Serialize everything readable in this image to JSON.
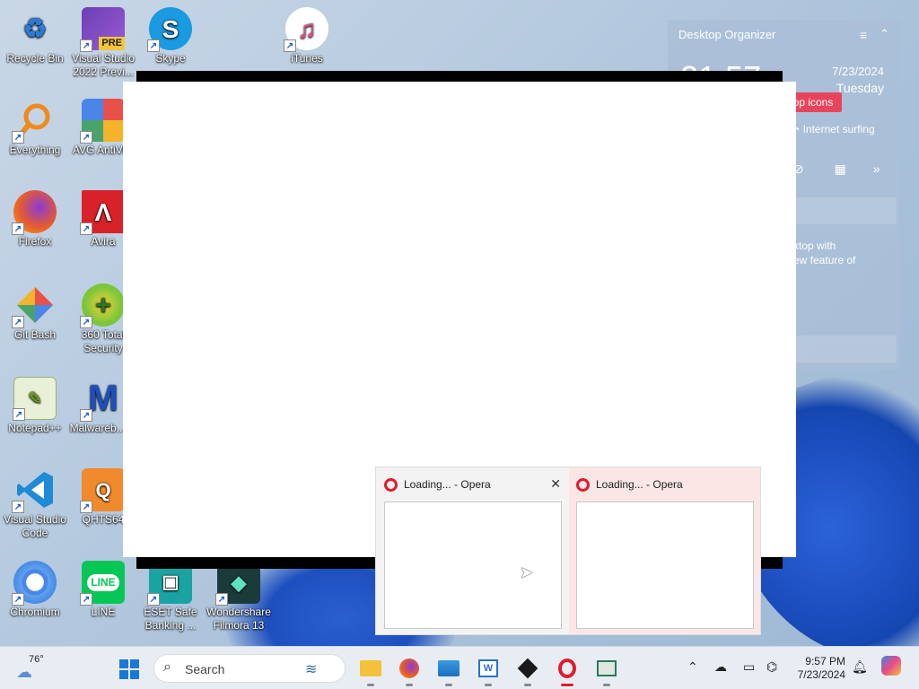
{
  "desktop": {
    "icons": [
      {
        "label": "Recycle Bin",
        "glyph": "♻"
      },
      {
        "label": "Visual Studio 2022 Previ...",
        "badge": "PRE"
      },
      {
        "label": "Skype",
        "glyph": "S"
      },
      {
        "label": "iTunes",
        "glyph": "♫"
      },
      {
        "label": "Everything",
        "glyph": "○"
      },
      {
        "label": "AVG AntiVi...",
        "glyph": ""
      },
      {
        "label": "Firefox",
        "glyph": ""
      },
      {
        "label": "Avira",
        "glyph": ""
      },
      {
        "label": "Git Bash",
        "glyph": "◆"
      },
      {
        "label": "360 Total Security",
        "glyph": "+"
      },
      {
        "label": "Notepad++",
        "glyph": ""
      },
      {
        "label": "Malwareb...es",
        "glyph": "M"
      },
      {
        "label": "Visual Studio Code",
        "glyph": ""
      },
      {
        "label": "QHTS64",
        "glyph": "Q"
      },
      {
        "label": "Chromium",
        "glyph": "◯"
      },
      {
        "label": "LINE",
        "glyph": "LINE"
      },
      {
        "label": "ESET Safe Banking ...",
        "glyph": ""
      },
      {
        "label": "Wondershare Filmora 13",
        "glyph": "◆"
      }
    ]
  },
  "organizer": {
    "title": "Desktop Organizer",
    "time": "21:57",
    "date": "7/23/2024",
    "day": "Tuesday",
    "pill": "op icons",
    "surf": "Internet surfing",
    "tip_line1": "ktop with",
    "tip_line2": "ew feature of"
  },
  "previews": [
    {
      "title": "Loading... - Opera",
      "close": "✕"
    },
    {
      "title": "Loading... - Opera"
    }
  ],
  "taskbar": {
    "temp": "76°",
    "search_label": "Search",
    "time": "9:57 PM",
    "date": "7/23/2024"
  }
}
